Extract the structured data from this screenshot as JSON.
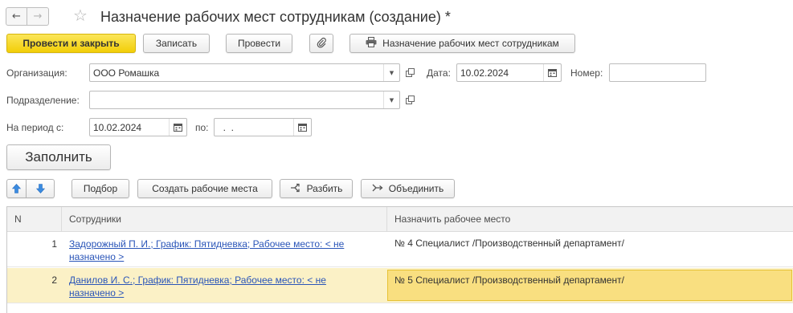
{
  "window": {
    "title": "Назначение рабочих мест сотрудникам (создание) *"
  },
  "toolbar": {
    "post_close_label": "Провести и закрыть",
    "save_label": "Записать",
    "post_label": "Провести",
    "print_label": "Назначение рабочих мест сотрудникам"
  },
  "form": {
    "organization_label": "Организация:",
    "organization_value": "ООО Ромашка",
    "date_label": "Дата:",
    "date_value": "10.02.2024",
    "number_label": "Номер:",
    "number_value": "",
    "department_label": "Подразделение:",
    "department_value": "",
    "period_from_label": "На период с:",
    "period_from_value": "10.02.2024",
    "period_to_label": "по:",
    "period_to_value": "  .  .",
    "fill_label": "Заполнить"
  },
  "table_toolbar": {
    "pick_label": "Подбор",
    "create_workplaces_label": "Создать рабочие места",
    "split_label": "Разбить",
    "merge_label": "Объединить"
  },
  "table": {
    "columns": [
      "N",
      "Сотрудники",
      "Назначить рабочее место"
    ],
    "rows": [
      {
        "n": "1",
        "employee_line1": "Задорожный П. И.; График: Пятидневка; Рабочее место: < не",
        "employee_line2": "назначено >",
        "workplace": "№ 4 Специалист /Производственный департамент/"
      },
      {
        "n": "2",
        "employee_line1": "Данилов И. С.; График: Пятидневка; Рабочее место: < не",
        "employee_line2": "назначено >",
        "workplace": "№ 5 Специалист /Производственный департамент/"
      }
    ]
  },
  "colors": {
    "primary_button": "#f4d51d",
    "selected_row": "#fbf1c6",
    "selected_cell": "#f9df80",
    "link": "#2a55b8"
  },
  "icons": [
    "arrow-left-icon",
    "arrow-right-icon",
    "star-icon",
    "paperclip-icon",
    "printer-icon",
    "calendar-icon",
    "dropdown-icon",
    "open-icon",
    "move-up-icon",
    "move-down-icon",
    "split-icon",
    "merge-icon"
  ]
}
